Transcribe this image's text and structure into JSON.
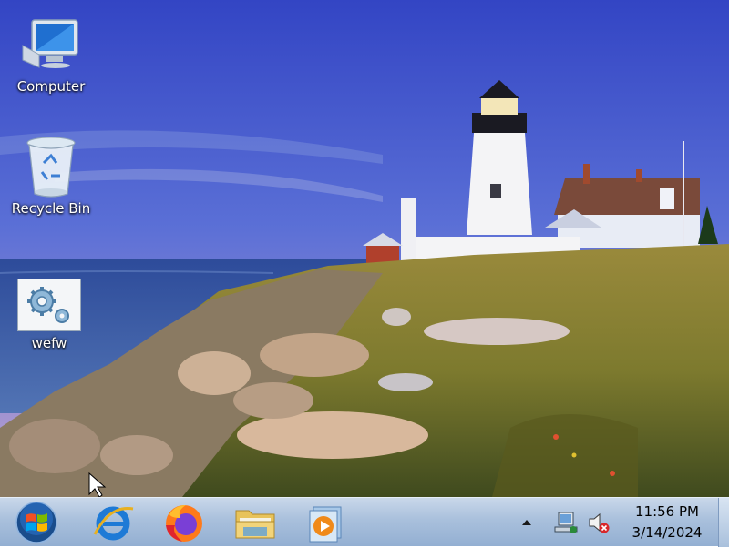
{
  "desktop": {
    "icons": [
      {
        "label": "Computer",
        "icon": "computer-icon"
      },
      {
        "label": "Recycle Bin",
        "icon": "recycle-bin-icon"
      },
      {
        "label": "wefw",
        "icon": "settings-gears-icon"
      }
    ]
  },
  "taskbar": {
    "start_button": "windows-logo-icon",
    "pinned": [
      {
        "name": "Internet Explorer",
        "icon": "internet-explorer-icon"
      },
      {
        "name": "Firefox",
        "icon": "firefox-icon"
      },
      {
        "name": "File Explorer",
        "icon": "folder-icon"
      },
      {
        "name": "Media Player",
        "icon": "media-player-icon"
      }
    ],
    "tray": {
      "icons": [
        "show-hidden-icons-arrow-icon",
        "network-icon",
        "volume-muted-icon"
      ],
      "time": "11:56 PM",
      "date": "3/14/2024"
    }
  },
  "colors": {
    "taskbar": "#a9c0dc",
    "sky": "#3b4fc8",
    "sea": "#2f4fa0"
  }
}
